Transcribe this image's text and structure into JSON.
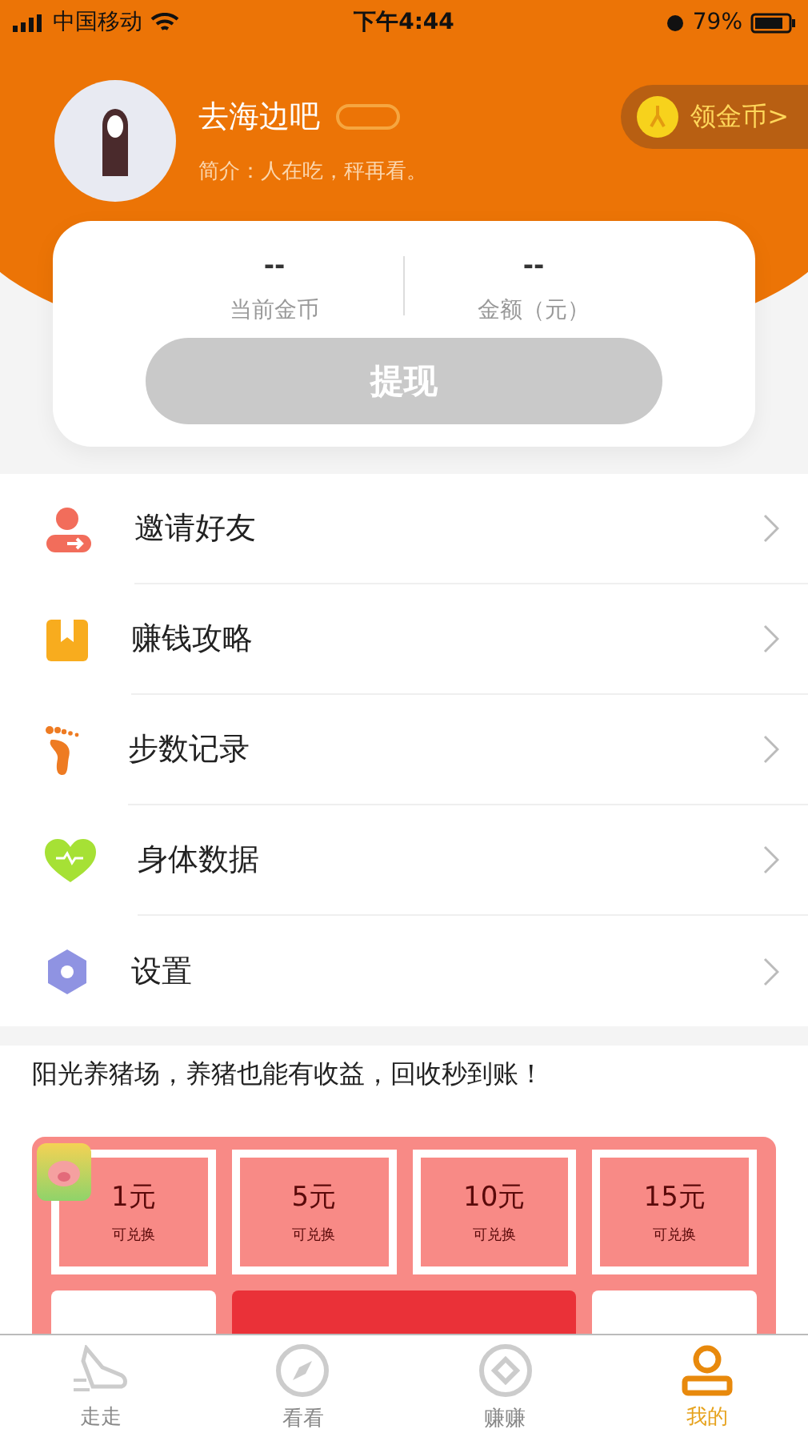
{
  "status_bar": {
    "carrier": "中国移动",
    "time": "下午4:44",
    "battery": "79%"
  },
  "profile": {
    "name": "去海边吧",
    "bio": "简介：人在吃，秤再看。",
    "reward_button": "领金币>"
  },
  "wallet": {
    "stats": [
      {
        "value": "--",
        "label": "当前金币"
      },
      {
        "value": "--",
        "label": "金额（元）"
      }
    ],
    "withdraw_button": {
      "label": "提现",
      "disabled": true
    }
  },
  "menu": [
    {
      "kind": "invite",
      "label": "邀请好友"
    },
    {
      "kind": "guide",
      "label": "赚钱攻略"
    },
    {
      "kind": "steps",
      "label": "步数记录"
    },
    {
      "kind": "health",
      "label": "身体数据"
    },
    {
      "kind": "settings",
      "label": "设置"
    }
  ],
  "promo": {
    "headline": "阳光养猪场，养猪也能有收益，回收秒到账！",
    "coupons": [
      {
        "amount": "1元",
        "note": "可兑换"
      },
      {
        "amount": "5元",
        "note": "可兑换"
      },
      {
        "amount": "10元",
        "note": "可兑换"
      },
      {
        "amount": "15元",
        "note": "可兑换"
      }
    ]
  },
  "tabs": [
    {
      "kind": "walk",
      "label": "走走",
      "selected": false
    },
    {
      "kind": "watch",
      "label": "看看",
      "selected": false
    },
    {
      "kind": "earn",
      "label": "赚赚",
      "selected": false
    },
    {
      "kind": "me",
      "label": "我的",
      "selected": true
    }
  ]
}
